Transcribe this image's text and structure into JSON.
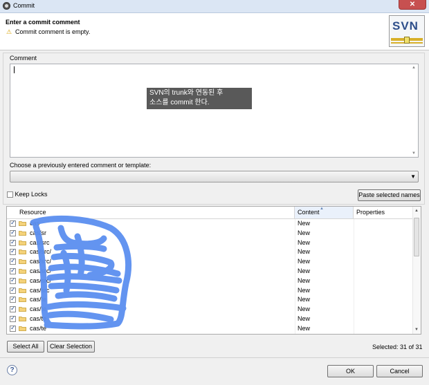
{
  "window": {
    "title": "Commit",
    "close_glyph": "✕"
  },
  "header": {
    "heading": "Enter a commit comment",
    "message": "Commit comment is empty.",
    "warning_glyph": "⚠",
    "logo_text": "SVN"
  },
  "comment": {
    "group_label": "Comment",
    "value": "",
    "tooltip_line1": "SVN의 trunk와 연동된 후",
    "tooltip_line2": "소스를 commit 한다."
  },
  "template": {
    "label": "Choose a previously entered comment or template:",
    "selected": ""
  },
  "keep_locks": {
    "label": "Keep Locks",
    "checked": false
  },
  "paste_button": "Paste selected names",
  "table": {
    "columns": [
      "Resource",
      "Content",
      "Properties"
    ],
    "sort_glyph": "▲",
    "rows": [
      {
        "resource": "cas",
        "content": "New"
      },
      {
        "resource": "cas/sr",
        "content": "New"
      },
      {
        "resource": "cas/src",
        "content": "New"
      },
      {
        "resource": "cas/src/",
        "content": "New"
      },
      {
        "resource": "cas/src/",
        "content": "New"
      },
      {
        "resource": "cas/src/",
        "content": "New"
      },
      {
        "resource": "cas/src/",
        "content": "New"
      },
      {
        "resource": "cas/src",
        "content": "New"
      },
      {
        "resource": "cas/te",
        "content": "New"
      },
      {
        "resource": "cas/te",
        "content": "New"
      },
      {
        "resource": "cas/te",
        "content": "New"
      },
      {
        "resource": "cas/te",
        "content": "New"
      }
    ]
  },
  "buttons": {
    "select_all": "Select All",
    "clear_selection": "Clear Selection",
    "ok": "OK",
    "cancel": "Cancel",
    "help": "?"
  },
  "status": {
    "selected": "Selected: 31 of 31"
  },
  "colors": {
    "scribble": "#5b8ff0"
  }
}
